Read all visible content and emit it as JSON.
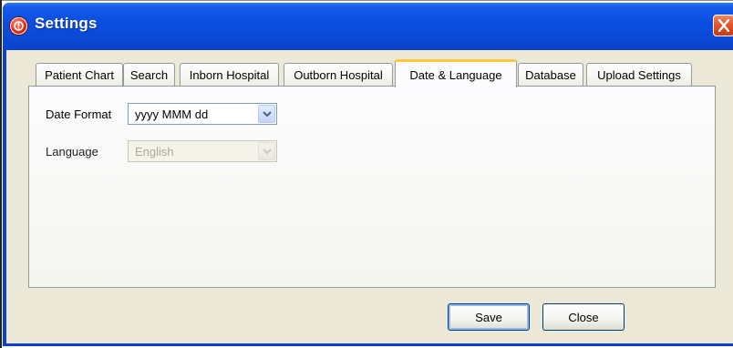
{
  "window": {
    "title": "Settings",
    "app_icon": "red-alert-circle-icon",
    "close_icon": "close-x-icon"
  },
  "tabs": [
    {
      "label": "Patient Chart",
      "active": false
    },
    {
      "label": "Search",
      "active": false
    },
    {
      "label": "Inborn Hospital",
      "active": false
    },
    {
      "label": "Outborn Hospital",
      "active": false
    },
    {
      "label": "Date & Language",
      "active": true
    },
    {
      "label": "Database",
      "active": false
    },
    {
      "label": "Upload Settings",
      "active": false
    }
  ],
  "form": {
    "date_format": {
      "label": "Date Format",
      "value": "yyyy MMM dd",
      "enabled": true
    },
    "language": {
      "label": "Language",
      "value": "English",
      "enabled": false
    }
  },
  "buttons": {
    "save": "Save",
    "close": "Close"
  },
  "colors": {
    "titlebar": "#0a48d6",
    "active_tab_accent": "#ffc83c",
    "window_face": "#ece9d8"
  }
}
